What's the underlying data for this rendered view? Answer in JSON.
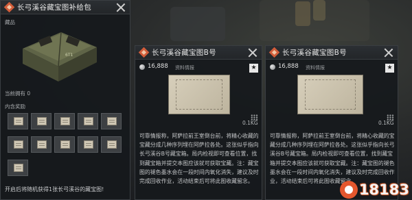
{
  "supply_panel": {
    "title": "长弓溪谷藏宝图补给包",
    "section_label": "藏品",
    "box_mark": "6T1",
    "owned_text": "当前拥有 0",
    "contents_label": "内含奖励",
    "footer_text": "开启后将随机获得1张长弓溪谷的藏宝图!"
  },
  "cards": [
    {
      "title": "长弓溪谷藏宝图B号",
      "price": "16,888",
      "category": "资料情报",
      "star": "★",
      "weight": "0.1KG",
      "description": "可靠情报称，阿萨拉前王室倒台前，将精心收藏的宝藏分成几种序列埋在阿萨拉各处。这张似乎指向长弓溪谷B号藏宝箱。局内检视即可查看位置，找到藏宝箱并提交本图应该就可获取宝藏。注：藏宝图的褪色墨水会在一段时间内氧化消失，建议及时完成回收作业，活动结束后可将此图收藏留念。"
    },
    {
      "title": "长弓溪谷藏宝图B号",
      "price": "16,888",
      "category": "资料情报",
      "star": "★",
      "weight": "0.1KG",
      "description": "可靠情报称，阿萨拉前王室倒台前，将精心收藏的宝藏分成几种序列埋在阿萨拉各处。这张似乎指向长弓溪谷B号藏宝箱。局内检视即可查看位置，找到藏宝箱并提交本图应该就可获取宝藏。注：藏宝图的褪色墨水会在一段时间内氧化消失，建议及时完成回收作业，活动结束后可将此图收藏留念。"
    }
  ],
  "watermark": {
    "text": "18183"
  },
  "colors": {
    "accent": "#d25d3a",
    "panel_bg": "#16191c",
    "border": "#3a3e42"
  }
}
